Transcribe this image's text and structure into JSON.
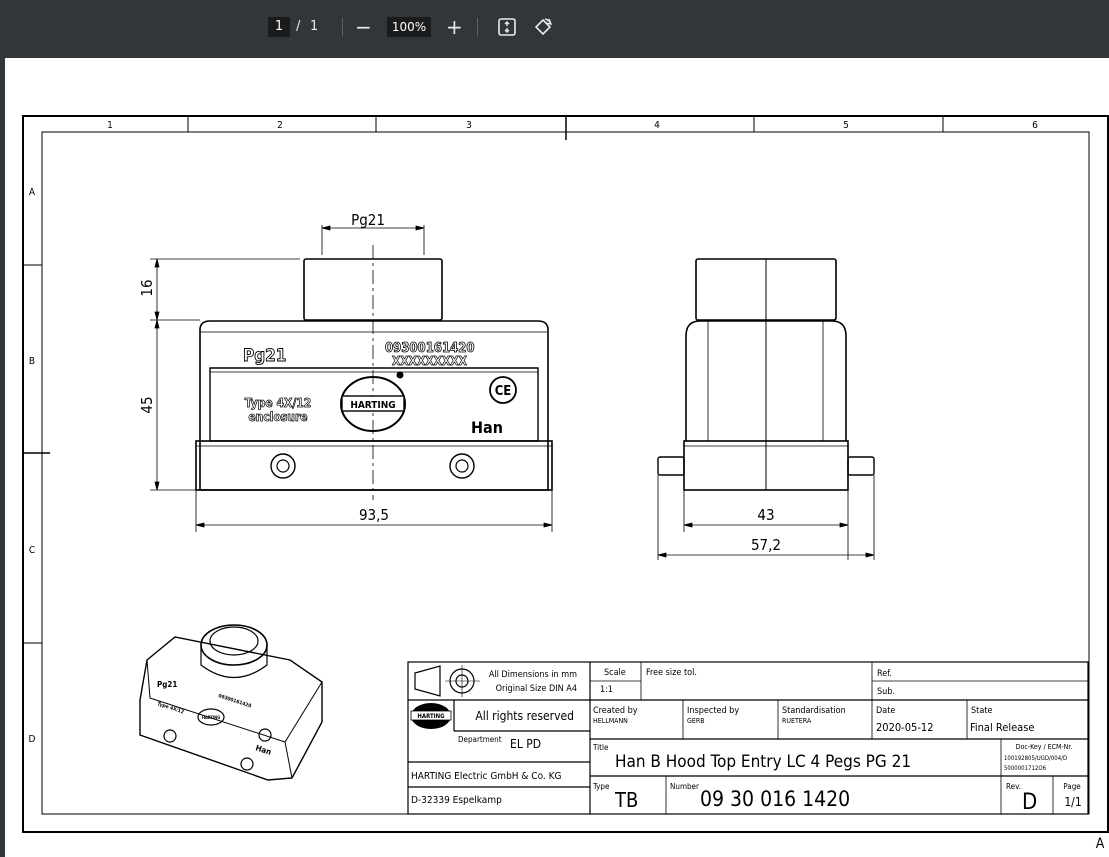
{
  "toolbar": {
    "page_current": "1",
    "page_separator": "/",
    "page_total": "1",
    "zoom_out_label": "−",
    "zoom_value": "100%",
    "zoom_in_label": "+",
    "fit_icon": "fit-page-icon",
    "rotate_icon": "rotate-icon"
  },
  "frame": {
    "columns": [
      "1",
      "2",
      "3",
      "4",
      "5",
      "6"
    ],
    "rows": [
      "A",
      "B",
      "C",
      "D"
    ],
    "corner_mark": "A"
  },
  "front_view": {
    "dim_top": "Pg21",
    "dim_16": "16",
    "dim_45": "45",
    "dim_width": "93,5",
    "label_pg": "Pg21",
    "part_number": "09300161420",
    "serial": "XXXXXXXXX",
    "type_line1": "Type 4X/12",
    "type_line2": "enclosure",
    "brand": "HARTING",
    "ce_mark": "CE",
    "han": "Han"
  },
  "side_view": {
    "dim_43": "43",
    "dim_57": "57,2"
  },
  "iso_view": {
    "label_pg": "Pg21",
    "type_text": "Type 4X/12",
    "part_number": "09300161420",
    "brand": "HARTING",
    "han": "Han"
  },
  "title_block": {
    "dims_line1": "All Dimensions in mm",
    "dims_line2": "Original Size DIN A4",
    "scale_label": "Scale",
    "scale_value": "1:1",
    "free_size": "Free size tol.",
    "ref_label": "Ref.",
    "sub_label": "Sub.",
    "rights": "All rights reserved",
    "department_label": "Department",
    "department_value": "EL PD",
    "company": "HARTING Electric GmbH & Co. KG",
    "address": "D-32339 Espelkamp",
    "created_label": "Created by",
    "created_value": "HELLMANN",
    "inspected_label": "Inspected by",
    "inspected_value": "GERB",
    "std_label": "Standardisation",
    "std_value": "RUETERA",
    "date_label": "Date",
    "date_value": "2020-05-12",
    "state_label": "State",
    "state_value": "Final Release",
    "title_label": "Title",
    "title_value": "Han B Hood Top Entry LC 4 Pegs PG 21",
    "dockey_line1": "Doc-Key / ECM-Nr.",
    "dockey_line2": "100192805/UGD/004/D",
    "dockey_line3": "5000001712O6",
    "type_label": "Type",
    "type_value": "TB",
    "number_label": "Number",
    "number_value": "09 30 016 1420",
    "rev_label": "Rev.",
    "rev_value": "D",
    "page_label": "Page",
    "page_value": "1/1"
  }
}
